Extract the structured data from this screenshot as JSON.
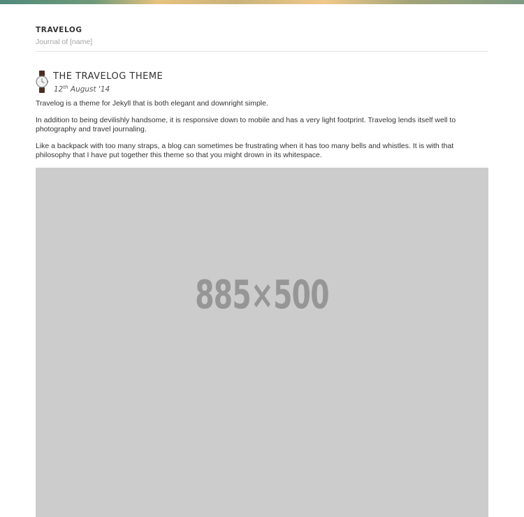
{
  "site": {
    "title": "TRAVELOG",
    "tagline": "Journal of [name]"
  },
  "post": {
    "title": "THE TRAVELOG THEME",
    "date": {
      "day": "12",
      "suffix": "th",
      "rest": " August '14"
    },
    "paragraphs": [
      "Travelog is a theme for Jekyll that is both elegant and downright simple.",
      "In addition to being devilishly handsome, it is responsive down to mobile and has a very light footprint. Travelog lends itself well to photography and travel journaling.",
      "Like a backpack with too many straps, a blog can sometimes be frustrating when it has too many bells and whistles. It is with that philosophy that I have put together this theme so that you might drown in its whitespace."
    ],
    "image_placeholder": "885×500",
    "icon": "watch-icon"
  },
  "colors": {
    "placeholder_bg": "#cccccc",
    "placeholder_text": "#969696",
    "tagline": "#a4a4a4"
  }
}
